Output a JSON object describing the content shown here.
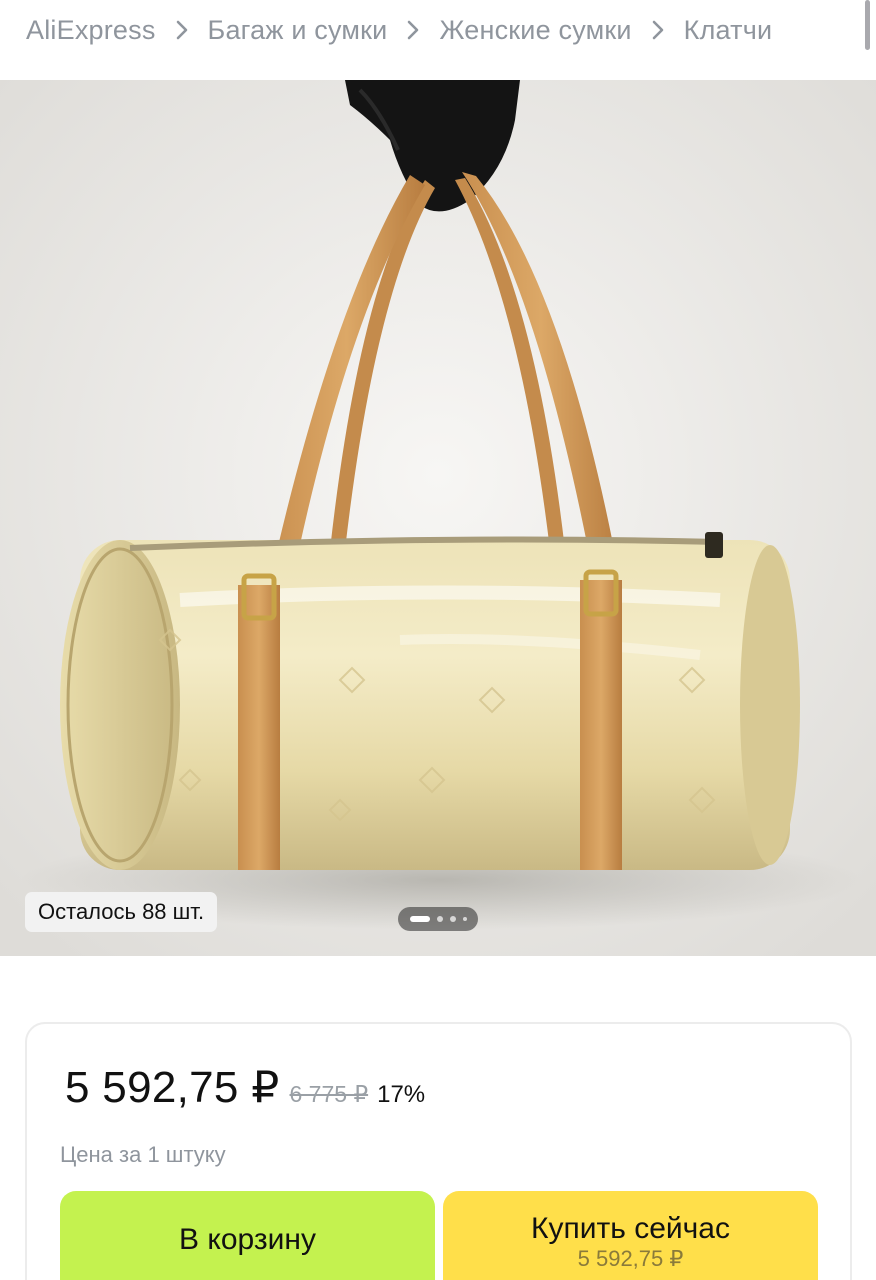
{
  "breadcrumb": {
    "items": [
      "AliExpress",
      "Багаж и сумки",
      "Женские сумки",
      "Клатчи"
    ]
  },
  "gallery": {
    "stock_label": "Осталось 88 шт.",
    "pager": {
      "total": 4,
      "active": 1
    }
  },
  "price": {
    "current": "5 592,75 ₽",
    "old": "6 775 ₽",
    "discount": "17%",
    "unit_note": "Цена за 1 штуку"
  },
  "actions": {
    "cart_label": "В корзину",
    "buy_label": "Купить сейчас",
    "buy_price": "5 592,75 ₽"
  },
  "colors": {
    "cart_button": "#c4f24f",
    "buy_button": "#ffdf4a",
    "muted_text": "#8f959d"
  }
}
